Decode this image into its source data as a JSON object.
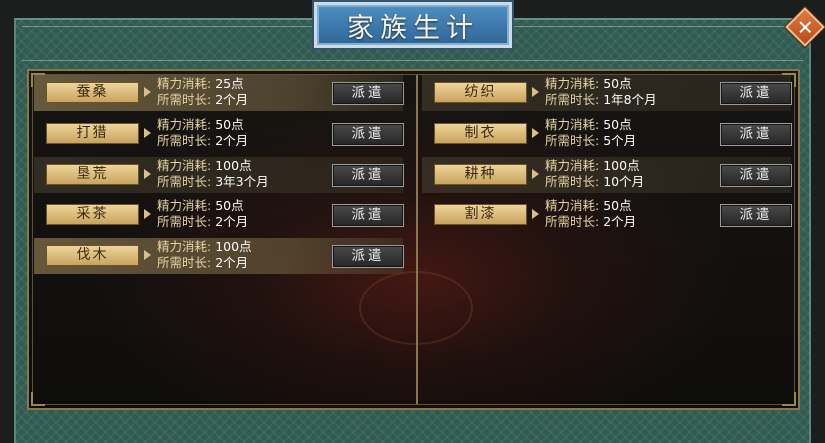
{
  "window": {
    "title": "家族生计",
    "close_symbol": "✕"
  },
  "labels": {
    "energy_cost": "精力消耗:",
    "duration": "所需时长:"
  },
  "left_tasks": [
    {
      "name": "蚕桑",
      "energy": "25点",
      "duration": "2个月",
      "button": "派遣"
    },
    {
      "name": "打猎",
      "energy": "50点",
      "duration": "2个月",
      "button": "派遣"
    },
    {
      "name": "垦荒",
      "energy": "100点",
      "duration": "3年3个月",
      "button": "派遣"
    },
    {
      "name": "采茶",
      "energy": "50点",
      "duration": "2个月",
      "button": "派遣"
    },
    {
      "name": "伐木",
      "energy": "100点",
      "duration": "2个月",
      "button": "派遣"
    }
  ],
  "right_tasks": [
    {
      "name": "纺织",
      "energy": "50点",
      "duration": "1年8个月",
      "button": "派遣"
    },
    {
      "name": "制衣",
      "energy": "50点",
      "duration": "5个月",
      "button": "派遣"
    },
    {
      "name": "耕种",
      "energy": "100点",
      "duration": "10个月",
      "button": "派遣"
    },
    {
      "name": "割漆",
      "energy": "50点",
      "duration": "2个月",
      "button": "派遣"
    }
  ],
  "colors": {
    "frame_green": "#2f5b51",
    "title_blue": "#3f7fb4",
    "gold": "#d9b877",
    "close_orange": "#d0632c"
  }
}
